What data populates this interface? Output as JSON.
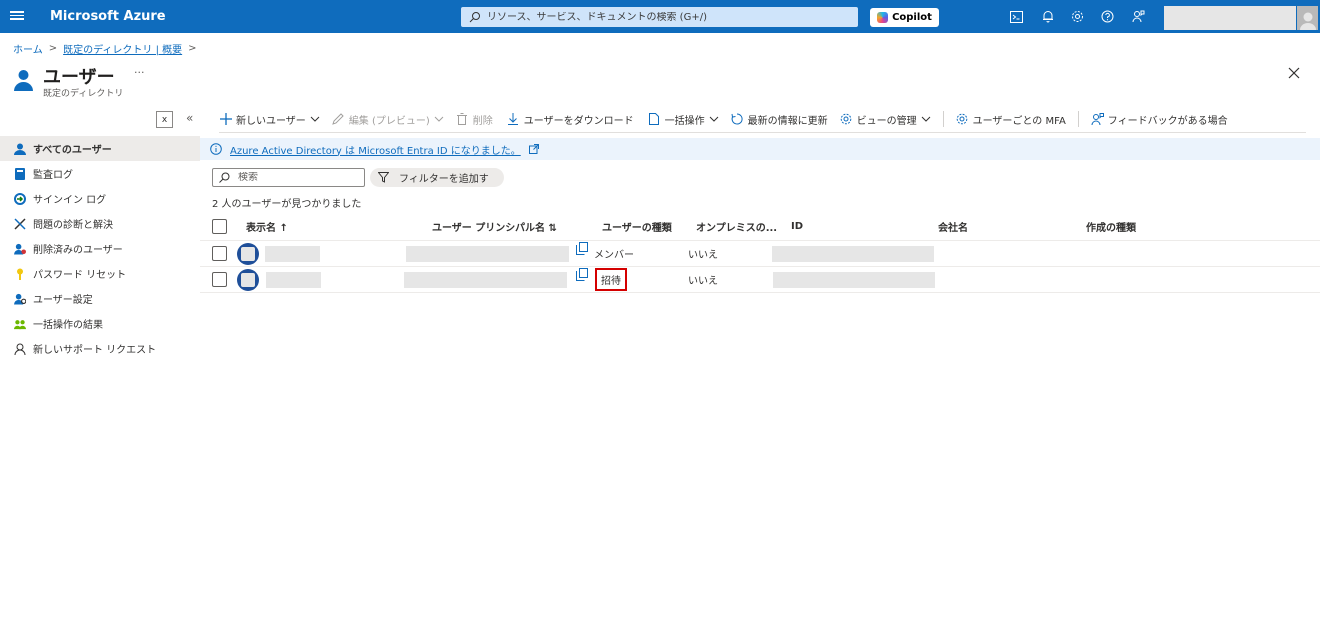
{
  "topbar": {
    "brand": "Microsoft Azure",
    "search_placeholder": "リソース、サービス、ドキュメントの検索 (G+/)",
    "copilot_label": "Copilot",
    "accent_color": "#0f6cbd"
  },
  "breadcrumb": {
    "home": "ホーム",
    "directory": "既定のディレクトリ | 概要"
  },
  "page": {
    "title": "ユーザー",
    "more": "···",
    "subtitle": "既定のディレクトリ"
  },
  "nav": {
    "collapse_x": "x",
    "collapse_arrow": "«",
    "items": [
      {
        "label": "すべてのユーザー",
        "icon": "user-icon"
      },
      {
        "label": "監査ログ",
        "icon": "book-icon"
      },
      {
        "label": "サインイン ログ",
        "icon": "signin-icon"
      },
      {
        "label": "問題の診断と解決",
        "icon": "wrench-icon"
      },
      {
        "label": "削除済みのユーザー",
        "icon": "deleted-user-icon"
      },
      {
        "label": "パスワード リセット",
        "icon": "key-icon"
      },
      {
        "label": "ユーザー設定",
        "icon": "user-settings-icon"
      },
      {
        "label": "一括操作の結果",
        "icon": "group-icon"
      },
      {
        "label": "新しいサポート リクエスト",
        "icon": "support-icon"
      }
    ]
  },
  "commands": {
    "new_user": "新しいユーザー",
    "edit": "編集 (プレビュー)",
    "delete": "削除",
    "download": "ユーザーをダウンロード",
    "bulk": "一括操作",
    "refresh": "最新の情報に更新",
    "manage_view": "ビューの管理",
    "mfa": "ユーザーごとの MFA",
    "feedback": "フィードバックがある場合"
  },
  "banner": {
    "text": "Azure Active Directory は Microsoft Entra ID になりました。"
  },
  "grid": {
    "search_placeholder": "検索",
    "filter_label": "フィルターを追加す",
    "result_count": "2 人のユーザーが見つかりました",
    "columns": {
      "display_name": "表示名 ↑",
      "upn": "ユーザー プリンシパル名 ⇅",
      "user_type": "ユーザーの種類",
      "on_prem": "オンプレミスの...",
      "id": "ID",
      "company": "会社名",
      "creation_type": "作成の種類"
    },
    "rows": [
      {
        "user_type": "メンバー",
        "on_prem": "いいえ"
      },
      {
        "user_type": "招待",
        "on_prem": "いいえ"
      }
    ]
  }
}
